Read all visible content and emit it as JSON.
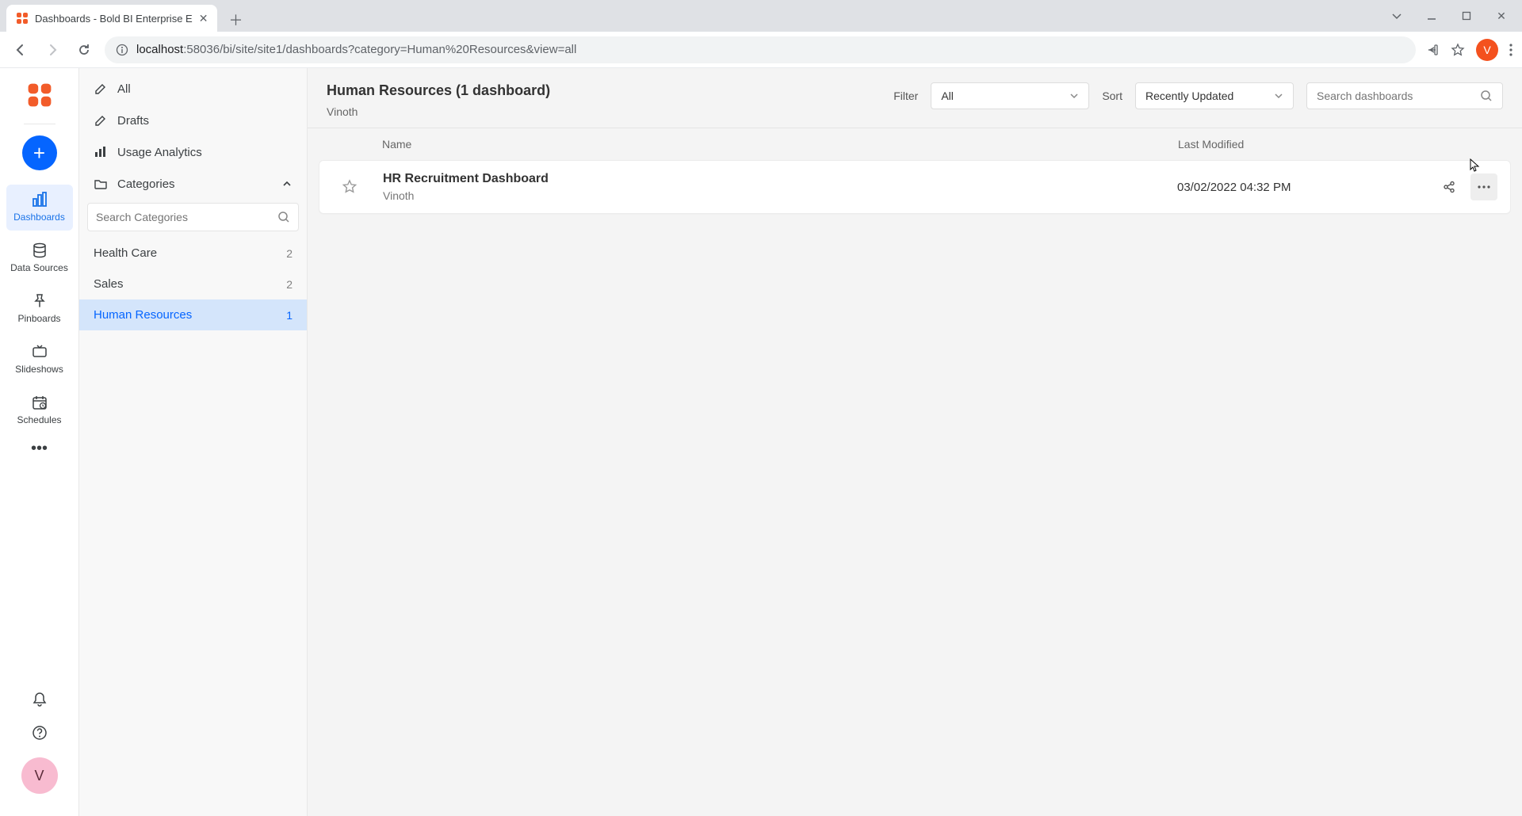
{
  "browser": {
    "tab_title": "Dashboards - Bold BI Enterprise E",
    "url_host": "localhost",
    "url_path": ":58036/bi/site/site1/dashboards?category=Human%20Resources&view=all",
    "avatar_letter": "V"
  },
  "rail": {
    "items": [
      {
        "id": "dashboards",
        "label": "Dashboards",
        "active": true
      },
      {
        "id": "datasources",
        "label": "Data Sources",
        "active": false
      },
      {
        "id": "pinboards",
        "label": "Pinboards",
        "active": false
      },
      {
        "id": "slideshows",
        "label": "Slideshows",
        "active": false
      },
      {
        "id": "schedules",
        "label": "Schedules",
        "active": false
      }
    ],
    "avatar_letter": "V"
  },
  "sidebar": {
    "all_label": "All",
    "drafts_label": "Drafts",
    "usage_label": "Usage Analytics",
    "categories_label": "Categories",
    "search_placeholder": "Search Categories",
    "categories": [
      {
        "name": "Health Care",
        "count": "2",
        "active": false
      },
      {
        "name": "Sales",
        "count": "2",
        "active": false
      },
      {
        "name": "Human Resources",
        "count": "1",
        "active": true
      }
    ]
  },
  "main": {
    "title": "Human Resources (1 dashboard)",
    "subtitle": "Vinoth",
    "filter_label": "Filter",
    "filter_value": "All",
    "sort_label": "Sort",
    "sort_value": "Recently Updated",
    "search_placeholder": "Search dashboards",
    "col_name": "Name",
    "col_modified": "Last Modified",
    "rows": [
      {
        "name": "HR Recruitment Dashboard",
        "author": "Vinoth",
        "modified": "03/02/2022 04:32 PM"
      }
    ]
  }
}
